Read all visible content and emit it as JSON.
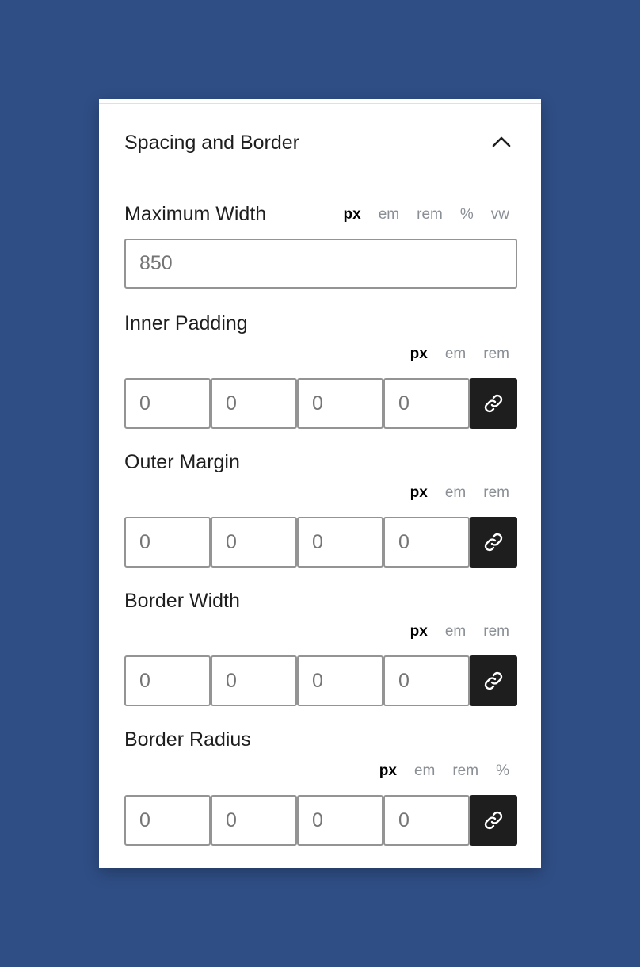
{
  "panel": {
    "title": "Spacing and Border",
    "collapse_icon": "chevron-up-icon"
  },
  "max_width": {
    "label": "Maximum Width",
    "units": [
      "px",
      "em",
      "rem",
      "%",
      "vw"
    ],
    "active_unit": "px",
    "placeholder": "850"
  },
  "inner_padding": {
    "label": "Inner Padding",
    "units": [
      "px",
      "em",
      "rem"
    ],
    "active_unit": "px",
    "placeholders": [
      "0",
      "0",
      "0",
      "0"
    ],
    "link_icon": "link-icon"
  },
  "outer_margin": {
    "label": "Outer Margin",
    "units": [
      "px",
      "em",
      "rem"
    ],
    "active_unit": "px",
    "placeholders": [
      "0",
      "0",
      "0",
      "0"
    ],
    "link_icon": "link-icon"
  },
  "border_width": {
    "label": "Border Width",
    "units": [
      "px",
      "em",
      "rem"
    ],
    "active_unit": "px",
    "placeholders": [
      "0",
      "0",
      "0",
      "0"
    ],
    "link_icon": "link-icon"
  },
  "border_radius": {
    "label": "Border Radius",
    "units": [
      "px",
      "em",
      "rem",
      "%"
    ],
    "active_unit": "px",
    "placeholders": [
      "0",
      "0",
      "0",
      "0"
    ],
    "link_icon": "link-icon"
  },
  "colors": {
    "background": "#2f4e85",
    "panel": "#ffffff",
    "link_button": "#1e1e1e"
  }
}
